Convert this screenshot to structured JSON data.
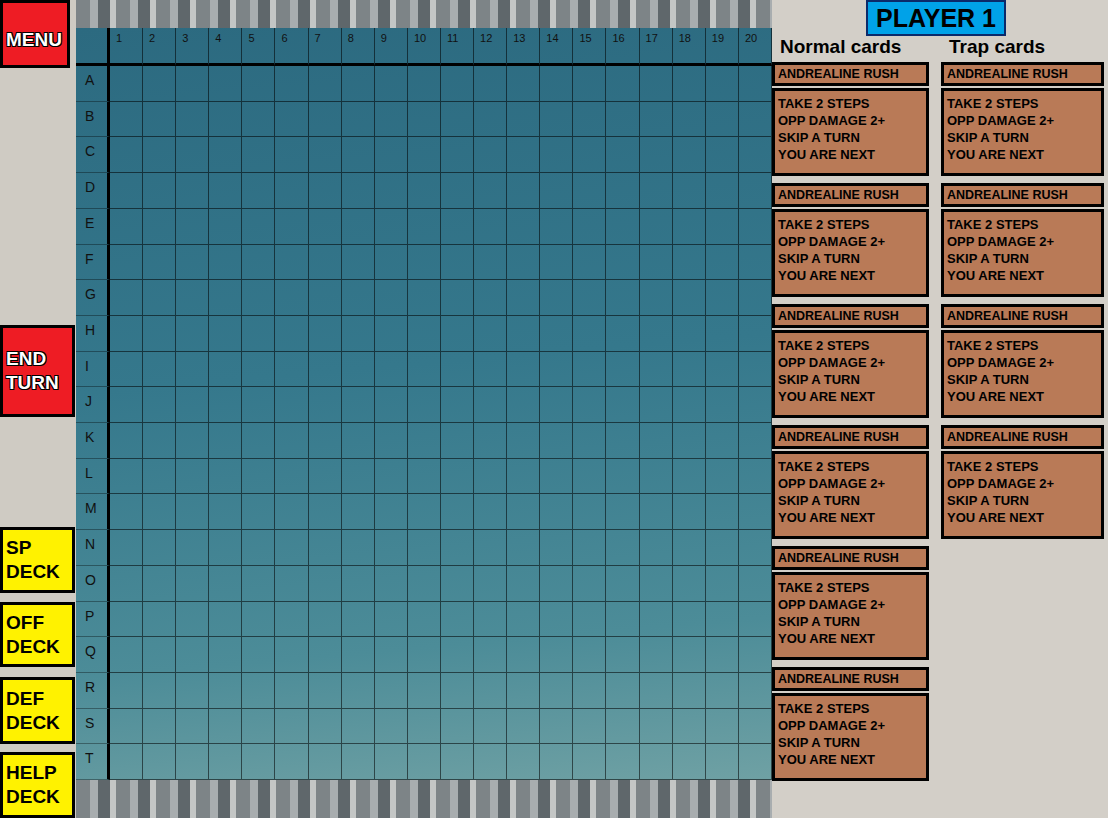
{
  "sidebar": {
    "buttons": [
      {
        "label": "MENU",
        "kind": "alert"
      },
      {
        "label": "END TURN",
        "kind": "alert"
      },
      {
        "label": "SP DECK",
        "kind": "deck"
      },
      {
        "label": "OFF DECK",
        "kind": "deck"
      },
      {
        "label": "DEF DECK",
        "kind": "deck"
      },
      {
        "label": "HELP DECK",
        "kind": "deck"
      }
    ]
  },
  "board": {
    "columns": [
      "1",
      "2",
      "3",
      "4",
      "5",
      "6",
      "7",
      "8",
      "9",
      "10",
      "11",
      "12",
      "13",
      "14",
      "15",
      "16",
      "17",
      "18",
      "19",
      "20"
    ],
    "rows": [
      "A",
      "B",
      "C",
      "D",
      "E",
      "F",
      "G",
      "H",
      "I",
      "J",
      "K",
      "L",
      "M",
      "N",
      "O",
      "P",
      "Q",
      "R",
      "S",
      "T"
    ]
  },
  "player": {
    "label": "PLAYER 1"
  },
  "hands": [
    {
      "title": "Normal cards",
      "cards": [
        {
          "title": "ANDREALINE RUSH",
          "lines": [
            "TAKE 2 STEPS",
            "OPP DAMAGE 2+",
            "SKIP A TURN",
            "YOU ARE NEXT"
          ]
        },
        {
          "title": "ANDREALINE RUSH",
          "lines": [
            "TAKE 2 STEPS",
            "OPP DAMAGE 2+",
            "SKIP A TURN",
            "YOU ARE NEXT"
          ]
        },
        {
          "title": "ANDREALINE RUSH",
          "lines": [
            "TAKE 2 STEPS",
            "OPP DAMAGE 2+",
            "SKIP A TURN",
            "YOU ARE NEXT"
          ]
        },
        {
          "title": "ANDREALINE RUSH",
          "lines": [
            "TAKE 2 STEPS",
            "OPP DAMAGE 2+",
            "SKIP A TURN",
            "YOU ARE NEXT"
          ]
        },
        {
          "title": "ANDREALINE RUSH",
          "lines": [
            "TAKE 2 STEPS",
            "OPP DAMAGE 2+",
            "SKIP A TURN",
            "YOU ARE NEXT"
          ]
        },
        {
          "title": "ANDREALINE RUSH",
          "lines": [
            "TAKE 2 STEPS",
            "OPP DAMAGE 2+",
            "SKIP A TURN",
            "YOU ARE NEXT"
          ]
        }
      ]
    },
    {
      "title": "Trap cards",
      "cards": [
        {
          "title": "ANDREALINE RUSH",
          "lines": [
            "TAKE 2 STEPS",
            "OPP DAMAGE 2+",
            "SKIP A TURN",
            "YOU ARE NEXT"
          ]
        },
        {
          "title": "ANDREALINE RUSH",
          "lines": [
            "TAKE 2 STEPS",
            "OPP DAMAGE 2+",
            "SKIP A TURN",
            "YOU ARE NEXT"
          ]
        },
        {
          "title": "ANDREALINE RUSH",
          "lines": [
            "TAKE 2 STEPS",
            "OPP DAMAGE 2+",
            "SKIP A TURN",
            "YOU ARE NEXT"
          ]
        },
        {
          "title": "ANDREALINE RUSH",
          "lines": [
            "TAKE 2 STEPS",
            "OPP DAMAGE 2+",
            "SKIP A TURN",
            "YOU ARE NEXT"
          ]
        }
      ]
    }
  ]
}
